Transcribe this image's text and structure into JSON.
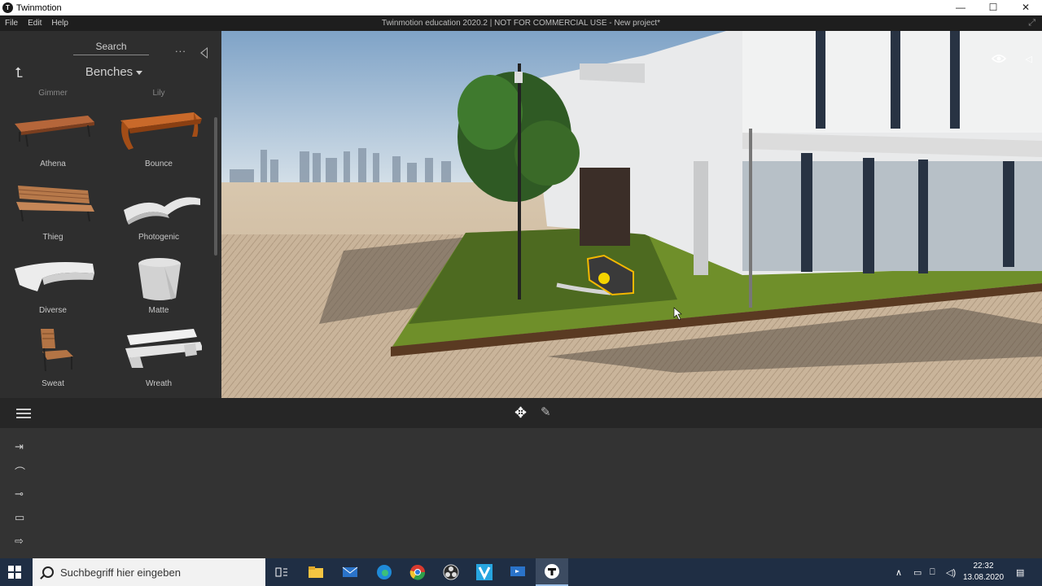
{
  "window": {
    "app_name": "Twinmotion",
    "app_icon_letter": "T",
    "minimize": "—",
    "maximize": "☐",
    "close": "✕"
  },
  "menu": {
    "items": [
      "File",
      "Edit",
      "Help"
    ],
    "document_title": "Twinmotion education 2020.2 | NOT FOR COMMERCIAL USE - New project*"
  },
  "library": {
    "search_label": "Search",
    "more": "...",
    "category": "Benches",
    "partial_items": [
      "Gimmer",
      "Lily"
    ],
    "assets": [
      {
        "name": "Athena",
        "icon": "bench-wood-icon"
      },
      {
        "name": "Bounce",
        "icon": "bench-orange-icon"
      },
      {
        "name": "Thieg",
        "icon": "bench-slat-icon"
      },
      {
        "name": "Photogenic",
        "icon": "bench-white-curve-icon"
      },
      {
        "name": "Diverse",
        "icon": "bench-white-long-icon"
      },
      {
        "name": "Matte",
        "icon": "stool-concrete-icon"
      },
      {
        "name": "Sweat",
        "icon": "chair-wood-icon"
      },
      {
        "name": "Wreath",
        "icon": "bench-white-icon"
      }
    ]
  },
  "colors": {
    "accent_selection": "#f5b800",
    "panel": "#2e2e2e",
    "taskbar": "#1f2e44"
  },
  "taskbar": {
    "search_placeholder": "Suchbegriff hier eingeben",
    "time": "22:32",
    "date": "13.08.2020",
    "apps": [
      "task-view-icon",
      "file-explorer-icon",
      "mail-icon",
      "edge-icon",
      "chrome-icon",
      "obs-icon",
      "v-app-icon",
      "remote-desktop-icon",
      "twinmotion-icon"
    ]
  }
}
